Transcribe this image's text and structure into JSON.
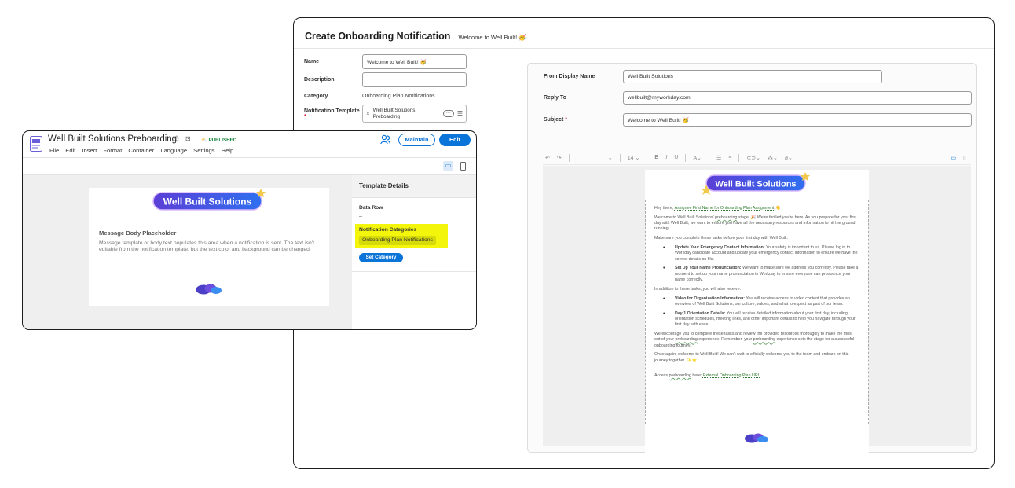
{
  "onboarding": {
    "title": "Create Onboarding Notification",
    "subtitle": "Welcome to Well Built! 🥳",
    "fields": {
      "name_label": "Name",
      "name_value": "Welcome to Well Built! 🥳",
      "description_label": "Description",
      "description_value": "",
      "category_label": "Category",
      "category_value": "Onboarding Plan Notifications",
      "template_label": "Notification Template",
      "template_required": "*",
      "template_value": "Well Built Solutions Preboarding"
    },
    "email": {
      "from_label": "From Display Name",
      "from_value": "Well Built Solutions",
      "reply_label": "Reply To",
      "reply_value": "wellbuilt@myworkday.com",
      "subject_label": "Subject",
      "subject_required": "*",
      "subject_value": "Welcome to Well Built! 🥳"
    },
    "toolbar": {
      "font_size": "14"
    },
    "body": {
      "banner": "Well Built Solutions",
      "greeting": "Hey there,",
      "assignee_field": "Assignee First Name for Onboarding Plan Assignment",
      "greeting_emoji": "👋",
      "p1_a": "Welcome to Well Built Solutions'",
      "p1_word": "preboarding",
      "p1_b": "stage! 🎉 We're thrilled you're here. As you prepare for your first day with Well Built, we want to ensure you have all the necessary resources and information to hit the ground running.",
      "p2": "Make sure you complete these tasks before your first day with Well Built:",
      "task1_title": "Update Your Emergency Contact Information:",
      "task1_text": "Your safety is important to us. Please log in to Workday candidate account and update your emergency contact information to ensure we have the correct details on file.",
      "task2_title": "Set Up Your Name Pronunciation:",
      "task2_text": "We want to make sure we address you correctly. Please take a moment to set up your name pronunciation in Workday to ensure everyone can pronounce your name correctly.",
      "p3": "In addition to these tasks, you will also receive:",
      "item1_title": "Video for Organization Information:",
      "item1_text": "You will receive access to video content that provides an overview of Well Built Solutions, our culture, values, and what to expect as part of our team.",
      "item2_title": "Day 1 Orientation Details:",
      "item2_text": "You will receive detailed information about your first day, including orientation schedules, meeting links, and other important details to help you navigate through your first day with ease.",
      "p4_a": "We encourage you to complete these tasks and review the provided resources thoroughly to make the most out of your",
      "p4_word1": "preboarding",
      "p4_b": "experience. Remember, your",
      "p4_word2": "preboarding",
      "p4_c": "experience sets the stage for a successful onboarding journey.",
      "p5": "Once again, welcome to Well Built! We can't wait to officially welcome you to the team and embark on this journey together. ✨⭐",
      "access_a": "Access",
      "access_word": "preboarding",
      "access_b": "here:",
      "access_link": "External Onboarding Plan URL"
    }
  },
  "template_editor": {
    "doc_title": "Well Built Solutions Preboarding",
    "status": "PUBLISHED",
    "menu": [
      "File",
      "Edit",
      "Insert",
      "Format",
      "Container",
      "Language",
      "Settings",
      "Help"
    ],
    "maintain_label": "Maintain",
    "edit_label": "Edit",
    "banner": "Well Built Solutions",
    "placeholder_heading": "Message Body Placeholder",
    "placeholder_text": "Message template or body text populates this area when a notification is sent. The text isn't editable from the notification template, but the text color and background can be changed.",
    "side": {
      "title": "Template Details",
      "data_row_label": "Data Row",
      "data_row_value": "–",
      "categories_label": "Notification Categories",
      "category_chip": "Onboarding Plan Notifications",
      "set_category_label": "Set Category"
    }
  },
  "colors": {
    "accent": "#0b74d8",
    "published": "#188038",
    "highlight": "#f3f50a",
    "banner_start": "#5b3fd6",
    "banner_end": "#2f6ff0"
  }
}
